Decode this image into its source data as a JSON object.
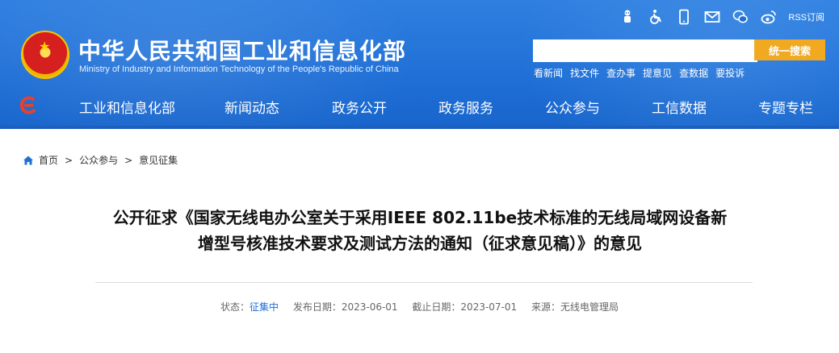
{
  "header": {
    "title_cn": "中华人民共和国工业和信息化部",
    "title_en": "Ministry of Industry and Information Technology of the People's Republic of China",
    "top_icons": [
      "accessibility-robot-icon",
      "wheelchair-icon",
      "mobile-icon",
      "mail-icon",
      "wechat-icon",
      "weibo-icon"
    ],
    "rss_label": "RSS订阅",
    "search_placeholder": "",
    "search_button": "统一搜索",
    "quick_links": [
      "看新闻",
      "找文件",
      "查办事",
      "提意见",
      "查数据",
      "要投诉"
    ]
  },
  "nav": {
    "items": [
      "工业和信息化部",
      "新闻动态",
      "政务公开",
      "政务服务",
      "公众参与",
      "工信数据",
      "专题专栏"
    ]
  },
  "breadcrumb": {
    "home": "首页",
    "separator": ">",
    "items": [
      "公众参与",
      "意见征集"
    ]
  },
  "article": {
    "title_line1": "公开征求《国家无线电办公室关于采用IEEE 802.11be技术标准的无线局域网设备新",
    "title_line2": "增型号核准技术要求及测试方法的通知（征求意见稿）》的意见",
    "meta": {
      "status_label": "状态：",
      "status_value": "征集中",
      "publish_label": "发布日期：",
      "publish_date": "2023-06-01",
      "deadline_label": "截止日期：",
      "deadline_date": "2023-07-01",
      "source_label": "来源：",
      "source_value": "无线电管理局"
    }
  },
  "colors": {
    "header_blue": "#1f6fd6",
    "search_button": "#f1a922",
    "status_blue": "#1f6fd6"
  }
}
